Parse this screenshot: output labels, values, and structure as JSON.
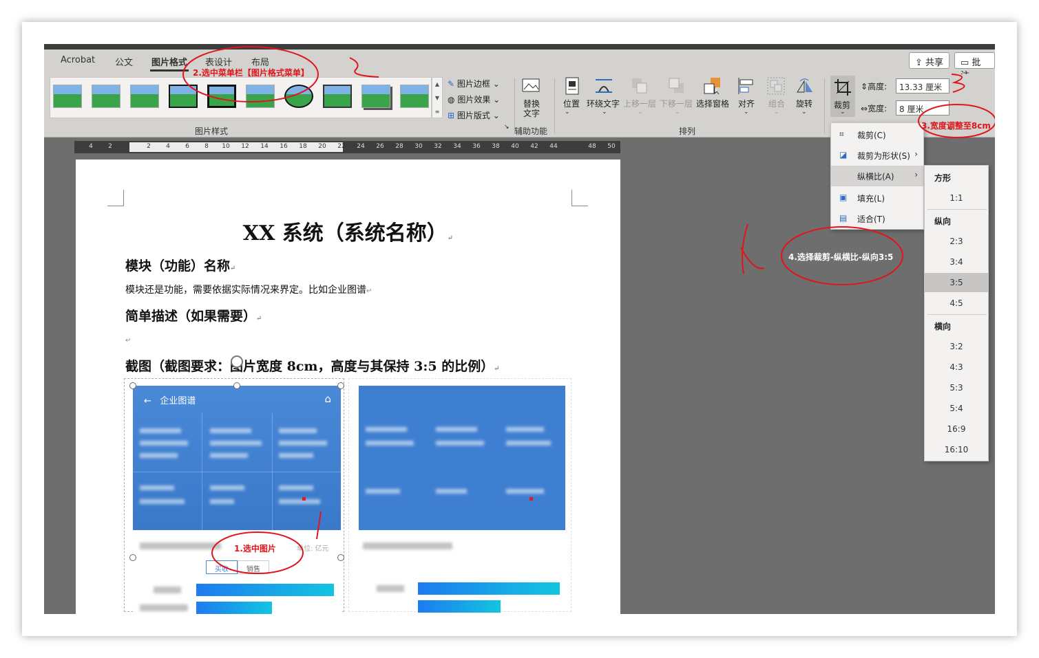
{
  "tabs": [
    {
      "label": "Acrobat"
    },
    {
      "label": "公文"
    },
    {
      "label": "图片格式"
    },
    {
      "label": "表设计"
    },
    {
      "label": "布局"
    }
  ],
  "top_right": {
    "share_label": "共享",
    "comment_label": "批注"
  },
  "ribbon": {
    "picture_border": "图片边框",
    "picture_effects": "图片效果",
    "picture_layout": "图片版式",
    "replace_text_line1": "替换",
    "replace_text_line2": "文字",
    "position": "位置",
    "wrap_text": "环绕文字",
    "bring_forward": "上移一层",
    "send_backward": "下移一层",
    "selection_pane": "选择窗格",
    "align": "对齐",
    "group": "组合",
    "rotate": "旋转",
    "crop": "裁剪",
    "height_label": "高度:",
    "height_value": "13.33 厘米",
    "width_label": "宽度:",
    "width_value": "8 厘米",
    "group_picture_styles": "图片样式",
    "group_accessibility": "辅助功能",
    "group_arrange": "排列"
  },
  "ruler_ticks": [
    "4",
    "2",
    "",
    "2",
    "4",
    "6",
    "8",
    "10",
    "12",
    "14",
    "16",
    "18",
    "20",
    "22",
    "24",
    "26",
    "28",
    "30",
    "32",
    "34",
    "36",
    "38",
    "40",
    "42",
    "44",
    "46",
    "48",
    "50"
  ],
  "document": {
    "title": "XX 系统（系统名称）",
    "heading1": "模块（功能）名称",
    "para1": "模块还是功能，需要依据实际情况来界定。比如企业图谱",
    "heading2": "简单描述（如果需要）",
    "heading3": "截图（截图要求：图片宽度 8cm，高度与其保持 3:5 的比例）",
    "para_mark": "↵"
  },
  "screenshot": {
    "header_title": "企业图谱",
    "unit_label": "单位: 亿元",
    "toggle_left": "买收",
    "toggle_right": "销售"
  },
  "crop_menu": {
    "items": [
      {
        "label": "裁剪(C)"
      },
      {
        "label": "裁剪为形状(S)"
      },
      {
        "label": "纵横比(A)"
      },
      {
        "label": "填充(L)"
      },
      {
        "label": "适合(T)"
      }
    ]
  },
  "aspect_menu": {
    "square_header": "方形",
    "square_items": [
      "1:1"
    ],
    "portrait_header": "纵向",
    "portrait_items": [
      "2:3",
      "3:4",
      "3:5",
      "4:5"
    ],
    "landscape_header": "横向",
    "landscape_items": [
      "3:2",
      "4:3",
      "5:3",
      "5:4",
      "16:9",
      "16:10"
    ],
    "selected": "3:5"
  },
  "annotations": {
    "step1": "1.选中图片",
    "step2": "2.选中菜单栏【图片格式菜单】",
    "step3": "3.宽度调整至8cm",
    "step4": "4.选择裁剪-纵横比-纵向3:5",
    "color": "#e0151b"
  }
}
